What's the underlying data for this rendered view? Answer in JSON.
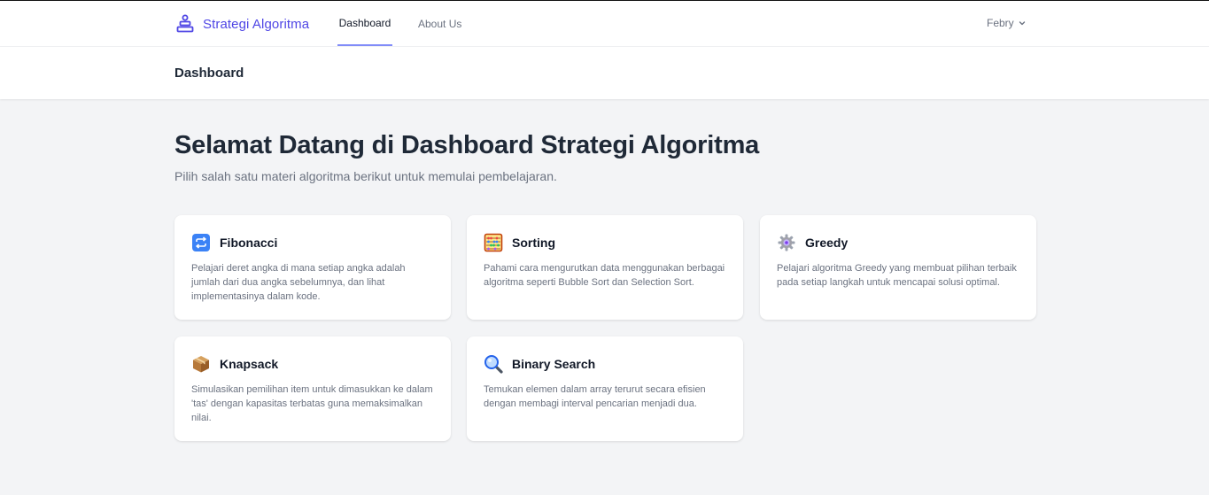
{
  "brand": {
    "name": "Strategi Algoritma",
    "logo_icon": "stack-layers-icon",
    "color": "#4f46e5"
  },
  "nav": {
    "links": [
      {
        "label": "Dashboard",
        "active": true
      },
      {
        "label": "About Us",
        "active": false
      }
    ]
  },
  "user": {
    "name": "Febry",
    "icon": "chevron-down-icon"
  },
  "header": {
    "title": "Dashboard"
  },
  "hero": {
    "title": "Selamat Datang di Dashboard Strategi Algoritma",
    "subtitle": "Pilih salah satu materi algoritma berikut untuk memulai pembelajaran."
  },
  "cards": [
    {
      "title": "Fibonacci",
      "icon": "repeat-arrows-icon",
      "desc": "Pelajari deret angka di mana setiap angka adalah jumlah dari dua angka sebelumnya, dan lihat implementasinya dalam kode."
    },
    {
      "title": "Sorting",
      "icon": "abacus-icon",
      "desc": "Pahami cara mengurutkan data menggunakan berbagai algoritma seperti Bubble Sort dan Selection Sort."
    },
    {
      "title": "Greedy",
      "icon": "gear-icon",
      "desc": "Pelajari algoritma Greedy yang membuat pilihan terbaik pada setiap langkah untuk mencapai solusi optimal."
    },
    {
      "title": "Knapsack",
      "icon": "package-icon",
      "desc": "Simulasikan pemilihan item untuk dimasukkan ke dalam 'tas' dengan kapasitas terbatas guna memaksimalkan nilai."
    },
    {
      "title": "Binary Search",
      "icon": "magnifier-icon",
      "desc": "Temukan elemen dalam array terurut secara efisien dengan membagi interval pencarian menjadi dua."
    }
  ],
  "colors": {
    "accent": "#4f46e5",
    "active_underline": "#818cf8",
    "background": "#f3f4f6"
  }
}
